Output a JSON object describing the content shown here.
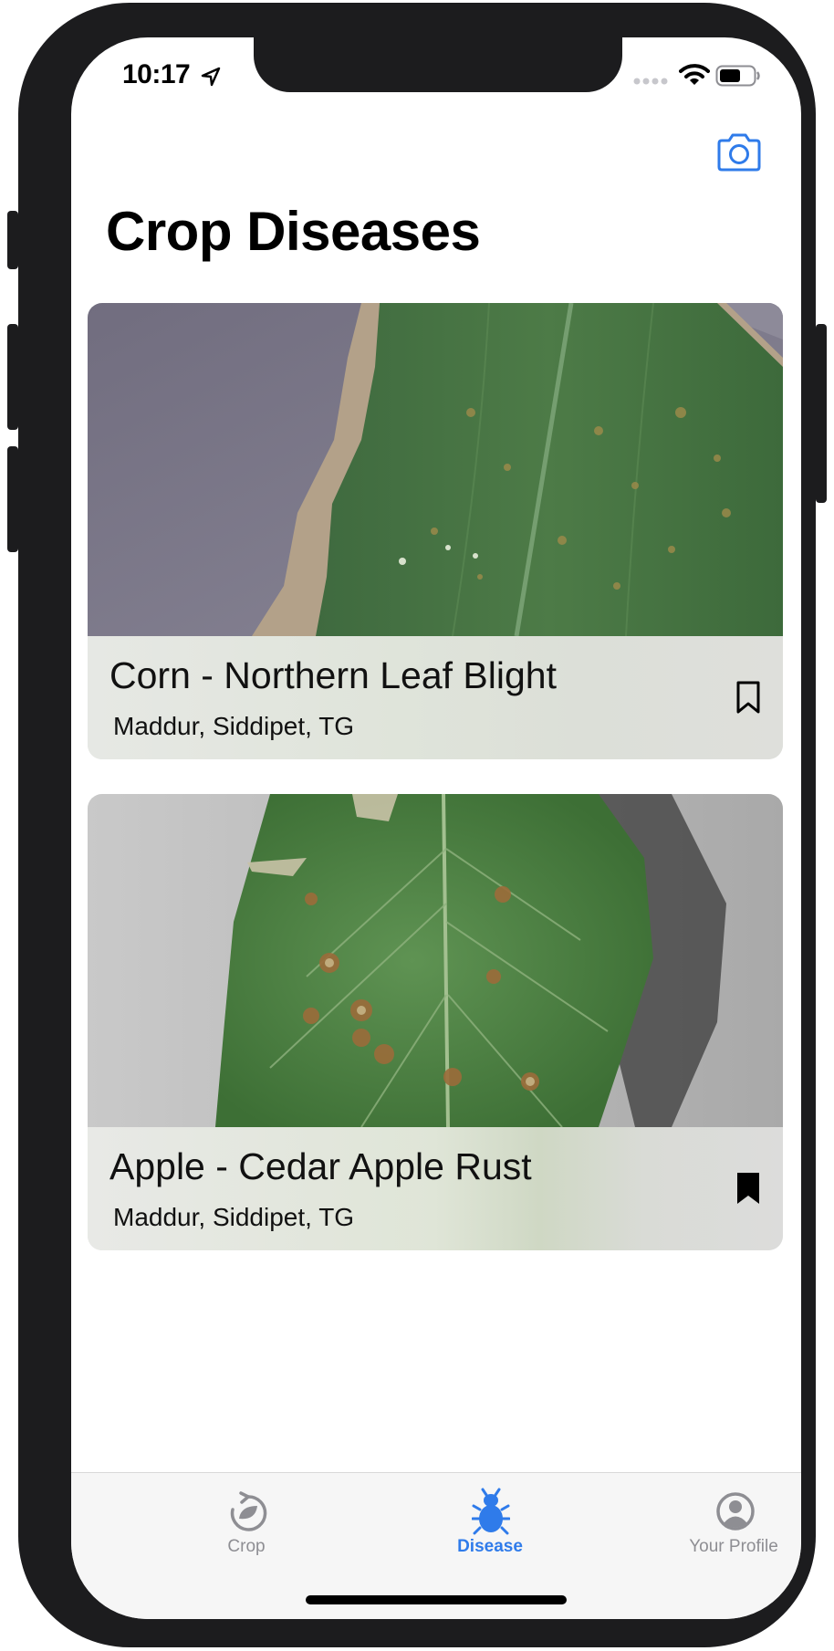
{
  "status_bar": {
    "time": "10:17"
  },
  "header": {
    "title": "Crop Diseases"
  },
  "cards": [
    {
      "title": "Corn - Northern Leaf Blight",
      "location": "Maddur, Siddipet, TG",
      "bookmarked": false
    },
    {
      "title": "Apple - Cedar Apple Rust",
      "location": "Maddur, Siddipet, TG",
      "bookmarked": true
    }
  ],
  "tabs": [
    {
      "label": "Crop",
      "icon": "crop-rotate-icon",
      "active": false
    },
    {
      "label": "Disease",
      "icon": "bug-icon",
      "active": true
    },
    {
      "label": "Your Profile",
      "icon": "profile-icon",
      "active": false
    }
  ],
  "colors": {
    "accent": "#2f7bea",
    "inactive": "#8e8e93",
    "frame": "#1c1c1e"
  }
}
